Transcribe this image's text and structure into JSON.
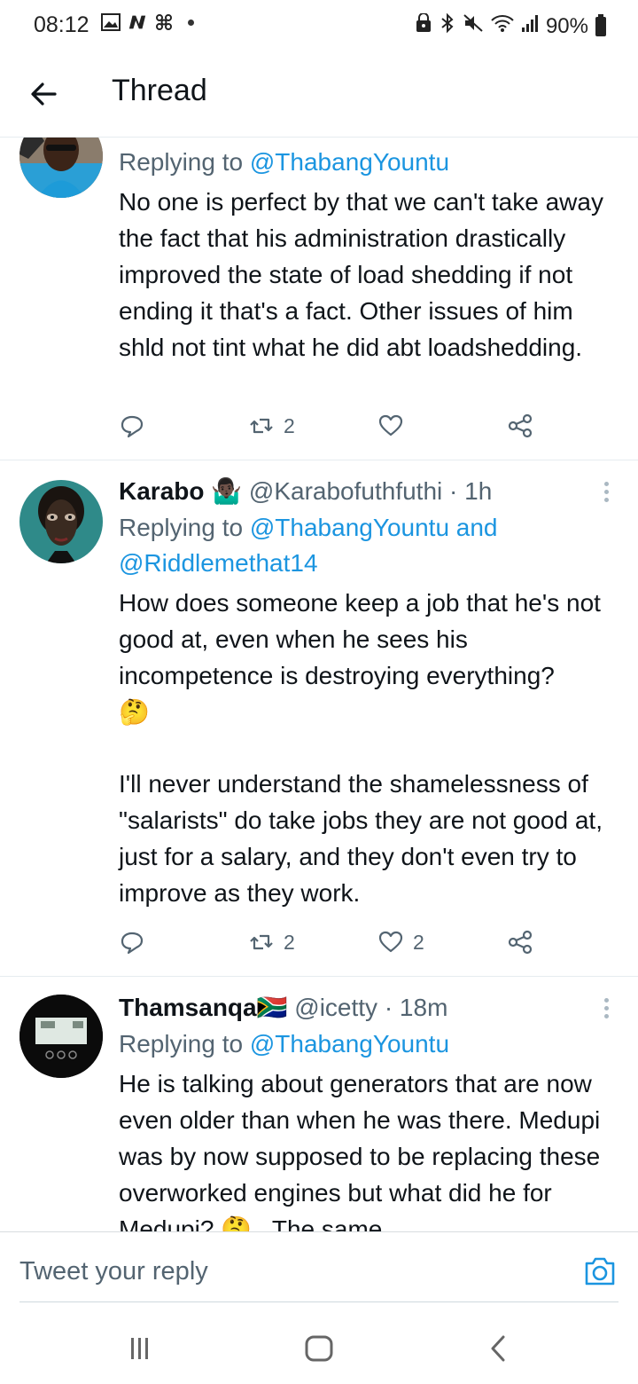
{
  "status_bar": {
    "time": "08:12",
    "battery": "90%",
    "left_icons": [
      "image-icon",
      "n-app-icon",
      "pinwheel-icon",
      "dot-icon"
    ],
    "right_icons": [
      "lock-icon",
      "bluetooth-icon",
      "mute-icon",
      "wifi-icon",
      "signal-icon",
      "battery-icon"
    ]
  },
  "header": {
    "title": "Thread"
  },
  "tweets": [
    {
      "reply_label": "Replying to",
      "reply_mentions": "@ThabangYountu",
      "text": "No one is perfect by that we can't take away the fact that his administration drastically improved the state of load shedding if not ending it that's a fact. Other issues of him shld not tint what he did abt loadshedding.",
      "retweets": "2",
      "likes": ""
    },
    {
      "name": "Karabo",
      "name_emoji": "🤷🏿‍♂️",
      "handle": "@Karabofuthfuthi",
      "time": "· 1h",
      "reply_label": "Replying to",
      "reply_mentions_1": "@ThabangYountu and",
      "reply_mentions_2": "@Riddlemethat14",
      "text_1": "How does someone keep a job that he's not good at, even when he sees his incompetence is destroying everything?",
      "text_emoji": "🤔",
      "text_2": "I'll never understand the shamelessness of \"salarists\" do take jobs they are not good at, just for a salary, and they don't even try to improve as they work.",
      "retweets": "2",
      "likes": "2"
    },
    {
      "name": "Thamsanqa",
      "name_emoji": "🇿🇦",
      "handle": "@icetty",
      "time": "· 18m",
      "reply_label": "Replying to",
      "reply_mentions": "@ThabangYountu",
      "text": "He is talking about generators that are now even older than when he was there. Medupi was by now supposed to be replacing these overworked engines but what did he for Medupi? 🤔 . The same"
    }
  ],
  "reply_bar": {
    "placeholder": "Tweet your reply"
  },
  "colors": {
    "accent": "#1b95e0",
    "text": "#0f1419",
    "secondary": "#536471",
    "divider": "#e6ecf0"
  }
}
